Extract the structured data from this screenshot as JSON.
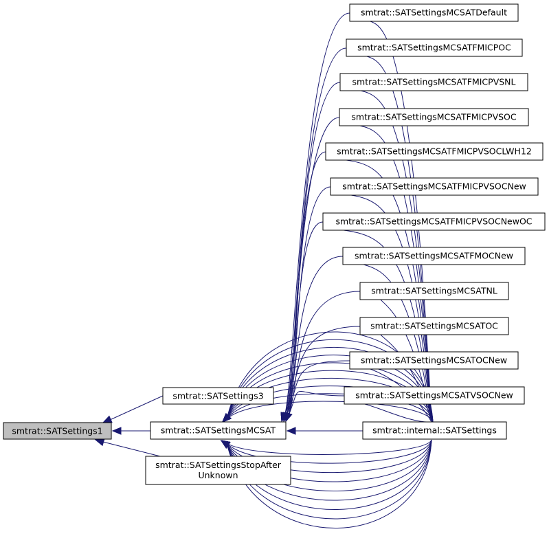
{
  "colors": {
    "edge": "#191970",
    "focus_fill": "#bfbfbf",
    "node_fill": "#ffffff",
    "node_border": "#000000"
  },
  "nodes": {
    "sat1": {
      "label": "smtrat::SATSettings1"
    },
    "sat3": {
      "label": "smtrat::SATSettings3"
    },
    "mcsat": {
      "label": "smtrat::SATSettingsMCSAT"
    },
    "stopafter": {
      "line1": "smtrat::SATSettingsStopAfter",
      "line2": "Unknown"
    },
    "internal": {
      "label": "smtrat::internal::SATSettings"
    },
    "mcsat_default": {
      "label": "smtrat::SATSettingsMCSATDefault"
    },
    "fmicpoc": {
      "label": "smtrat::SATSettingsMCSATFMICPOC"
    },
    "fmicpvsnl": {
      "label": "smtrat::SATSettingsMCSATFMICPVSNL"
    },
    "fmicpvsoc": {
      "label": "smtrat::SATSettingsMCSATFMICPVSOC"
    },
    "fmicpvsoclwh12": {
      "label": "smtrat::SATSettingsMCSATFMICPVSOCLWH12"
    },
    "fmicpvsocnew": {
      "label": "smtrat::SATSettingsMCSATFMICPVSOCNew"
    },
    "fmicpvsocnewoc": {
      "label": "smtrat::SATSettingsMCSATFMICPVSOCNewOC"
    },
    "fmocnew": {
      "label": "smtrat::SATSettingsMCSATFMOCNew"
    },
    "nl": {
      "label": "smtrat::SATSettingsMCSATNL"
    },
    "oc": {
      "label": "smtrat::SATSettingsMCSATOC"
    },
    "ocnew": {
      "label": "smtrat::SATSettingsMCSATOCNew"
    },
    "vsocnew": {
      "label": "smtrat::SATSettingsMCSATVSOCNew"
    }
  }
}
